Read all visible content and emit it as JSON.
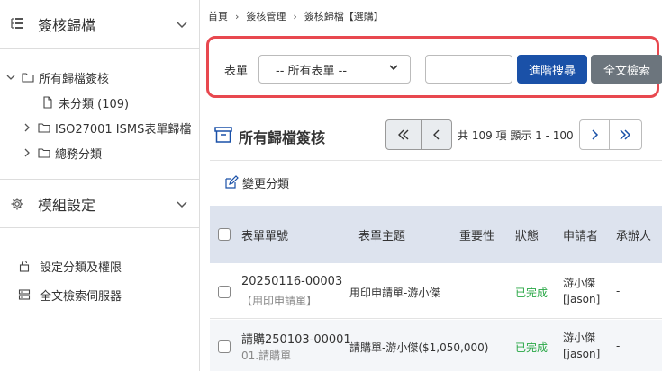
{
  "sidebar": {
    "section1": {
      "title": "簽核歸檔"
    },
    "tree": {
      "root": "所有歸檔簽核",
      "items": [
        {
          "label": "未分類 (109)"
        },
        {
          "label": "ISO27001 ISMS表單歸檔"
        },
        {
          "label": "總務分類"
        }
      ]
    },
    "section2": {
      "title": "模組設定"
    },
    "settings": [
      {
        "label": "設定分類及權限"
      },
      {
        "label": "全文檢索伺服器"
      }
    ]
  },
  "breadcrumb": [
    "首頁",
    "簽核管理",
    "簽核歸檔【選購】"
  ],
  "search": {
    "label": "表單",
    "select_value": "-- 所有表單 --",
    "input_value": "",
    "input_placeholder": "",
    "advanced_button": "進階搜尋",
    "fulltext_button": "全文檢索"
  },
  "list": {
    "title": "所有歸檔簽核",
    "pager_info": "共 109 項 顯示 1 - 100",
    "change_category": "變更分類"
  },
  "table": {
    "columns": [
      "表單單號",
      "表單主題",
      "重要性",
      "狀態",
      "申請者",
      "承辦人"
    ],
    "rows": [
      {
        "no": "20250116-00003",
        "form": "【用印申請單】",
        "subject": "用印申請單-游小傑",
        "importance": "",
        "status": "已完成",
        "applicant": "游小傑",
        "account": "[jason]",
        "handler": "-"
      },
      {
        "no": "請購250103-00001",
        "form": "01.請購單",
        "subject": "請購單-游小傑($1,050,000)",
        "importance": "",
        "status": "已完成",
        "applicant": "游小傑",
        "account": "[jason]",
        "handler": "-"
      }
    ]
  },
  "colors": {
    "accent": "#1a51a8",
    "highlight": "#e8484f",
    "status_done": "#28a745",
    "header_bg": "#dde3ee"
  }
}
